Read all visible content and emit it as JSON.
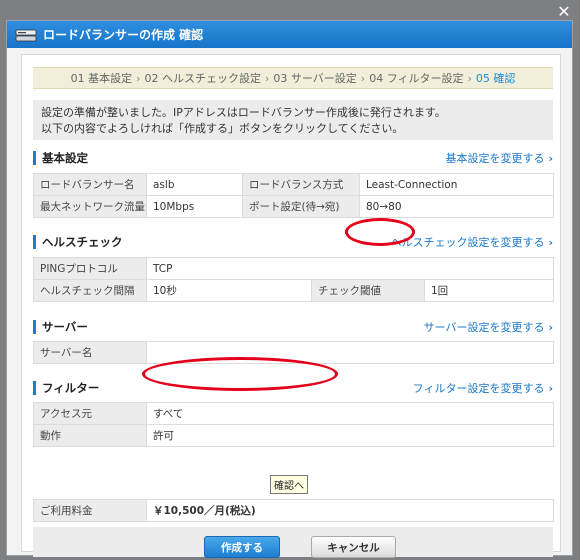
{
  "window": {
    "close_glyph": "✕"
  },
  "dialog": {
    "title": "ロードバランサーの作成  確認",
    "title_icon": "server-icon"
  },
  "steps": [
    {
      "label": "01 基本設定",
      "current": false
    },
    {
      "label": "02 ヘルスチェック設定",
      "current": false
    },
    {
      "label": "03 サーバー設定",
      "current": false
    },
    {
      "label": "04 フィルター設定",
      "current": false
    },
    {
      "label": "05 確認",
      "current": true
    }
  ],
  "step_arrow": "›",
  "intro": {
    "line1": "設定の準備が整いました。IPアドレスはロードバランサー作成後に発行されます。",
    "line2": "以下の内容でよろしければ「作成する」ボタンをクリックしてください。"
  },
  "basic": {
    "title": "基本設定",
    "link": "基本設定を変更する",
    "rows": [
      {
        "l1": "ロードバランサー名",
        "v1": "aslb",
        "l2": "ロードバランス方式",
        "v2": "Least-Connection"
      },
      {
        "l1": "最大ネットワーク流量",
        "v1": "10Mbps",
        "l2": "ポート設定(待→宛)",
        "v2": "80→80"
      }
    ]
  },
  "health": {
    "title": "ヘルスチェック",
    "link": "ヘルスチェック設定を変更する",
    "ping_label": "PINGプロトコル",
    "ping_value": "TCP",
    "interval_label": "ヘルスチェック間隔",
    "interval_value": "10秒",
    "threshold_label": "チェック閾値",
    "threshold_value": "1回"
  },
  "server": {
    "title": "サーバー",
    "link": "サーバー設定を変更する",
    "name_label": "サーバー名",
    "name_value": ""
  },
  "filter": {
    "title": "フィルター",
    "link": "フィルター設定を変更する",
    "source_label": "アクセス元",
    "source_value": "すべて",
    "action_label": "動作",
    "action_value": "許可"
  },
  "tooltip": "確認へ",
  "fee": {
    "label": "ご利用料金",
    "value": "￥10,500／月(税込)"
  },
  "buttons": {
    "create": "作成する",
    "cancel": "キャンセル"
  },
  "link_chevron": "›",
  "colors": {
    "accent": "#1c7bd3",
    "price": "#e0153a",
    "annotation": "#e4001b"
  }
}
